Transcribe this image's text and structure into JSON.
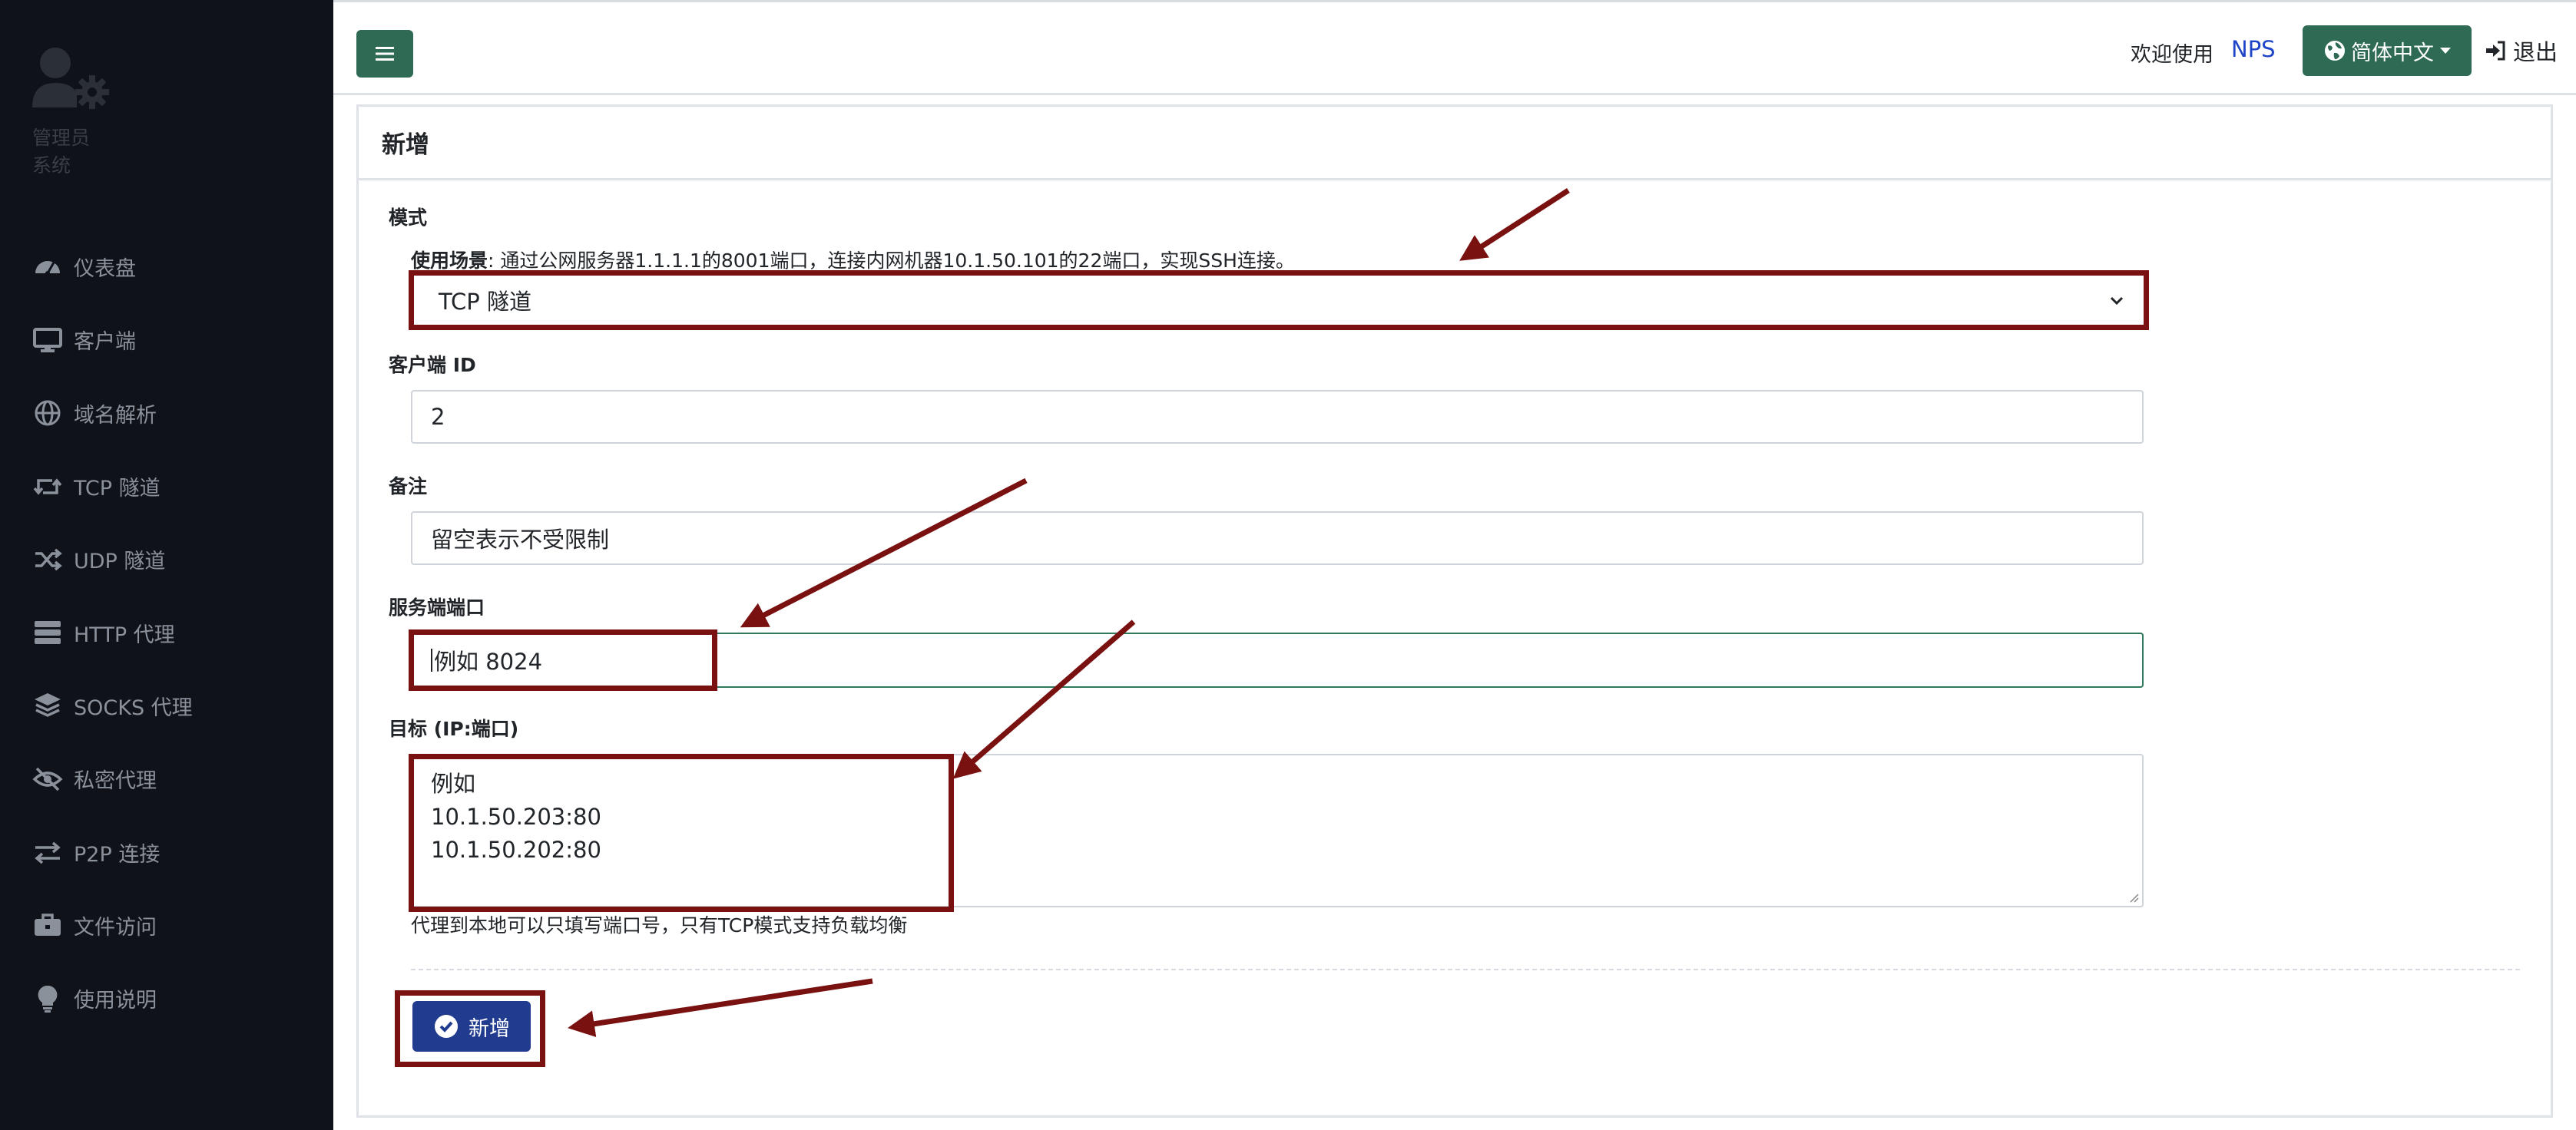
{
  "sidebar": {
    "user": {
      "role": "管理员",
      "system": "系统"
    },
    "items": [
      {
        "label": "仪表盘",
        "icon": "dashboard-icon"
      },
      {
        "label": "客户端",
        "icon": "monitor-icon"
      },
      {
        "label": "域名解析",
        "icon": "globe-icon"
      },
      {
        "label": "TCP 隧道",
        "icon": "retweet-icon"
      },
      {
        "label": "UDP 隧道",
        "icon": "shuffle-icon"
      },
      {
        "label": "HTTP 代理",
        "icon": "server-icon"
      },
      {
        "label": "SOCKS 代理",
        "icon": "layers-icon"
      },
      {
        "label": "私密代理",
        "icon": "eye-slash-icon"
      },
      {
        "label": "P2P 连接",
        "icon": "exchange-icon"
      },
      {
        "label": "文件访问",
        "icon": "briefcase-icon"
      },
      {
        "label": "使用说明",
        "icon": "lightbulb-icon"
      }
    ]
  },
  "topbar": {
    "welcome": "欢迎使用",
    "brand": "NPS",
    "language": "简体中文",
    "logout": "退出"
  },
  "form": {
    "title": "新增",
    "mode_label": "模式",
    "usage_prefix": "使用场景",
    "usage_text": ": 通过公网服务器1.1.1.1的8001端口，连接内网机器10.1.50.101的22端口，实现SSH连接。",
    "mode_value": "TCP 隧道",
    "client_id_label": "客户端 ID",
    "client_id_value": "2",
    "remark_label": "备注",
    "remark_placeholder": "留空表示不受限制",
    "server_port_label": "服务端端口",
    "server_port_placeholder": "例如 8024",
    "target_label": "目标 (IP:端口)",
    "target_placeholder_lines": [
      "例如",
      "10.1.50.203:80",
      "10.1.50.202:80"
    ],
    "target_help": "代理到本地可以只填写端口号，只有TCP模式支持负载均衡",
    "submit_label": "新增"
  },
  "colors": {
    "sidebar_bg": "#0f1218",
    "primary_green": "#2f6a54",
    "submit_blue": "#213c8f",
    "annotation_red": "#7a1111",
    "link_blue": "#1e44c7"
  }
}
